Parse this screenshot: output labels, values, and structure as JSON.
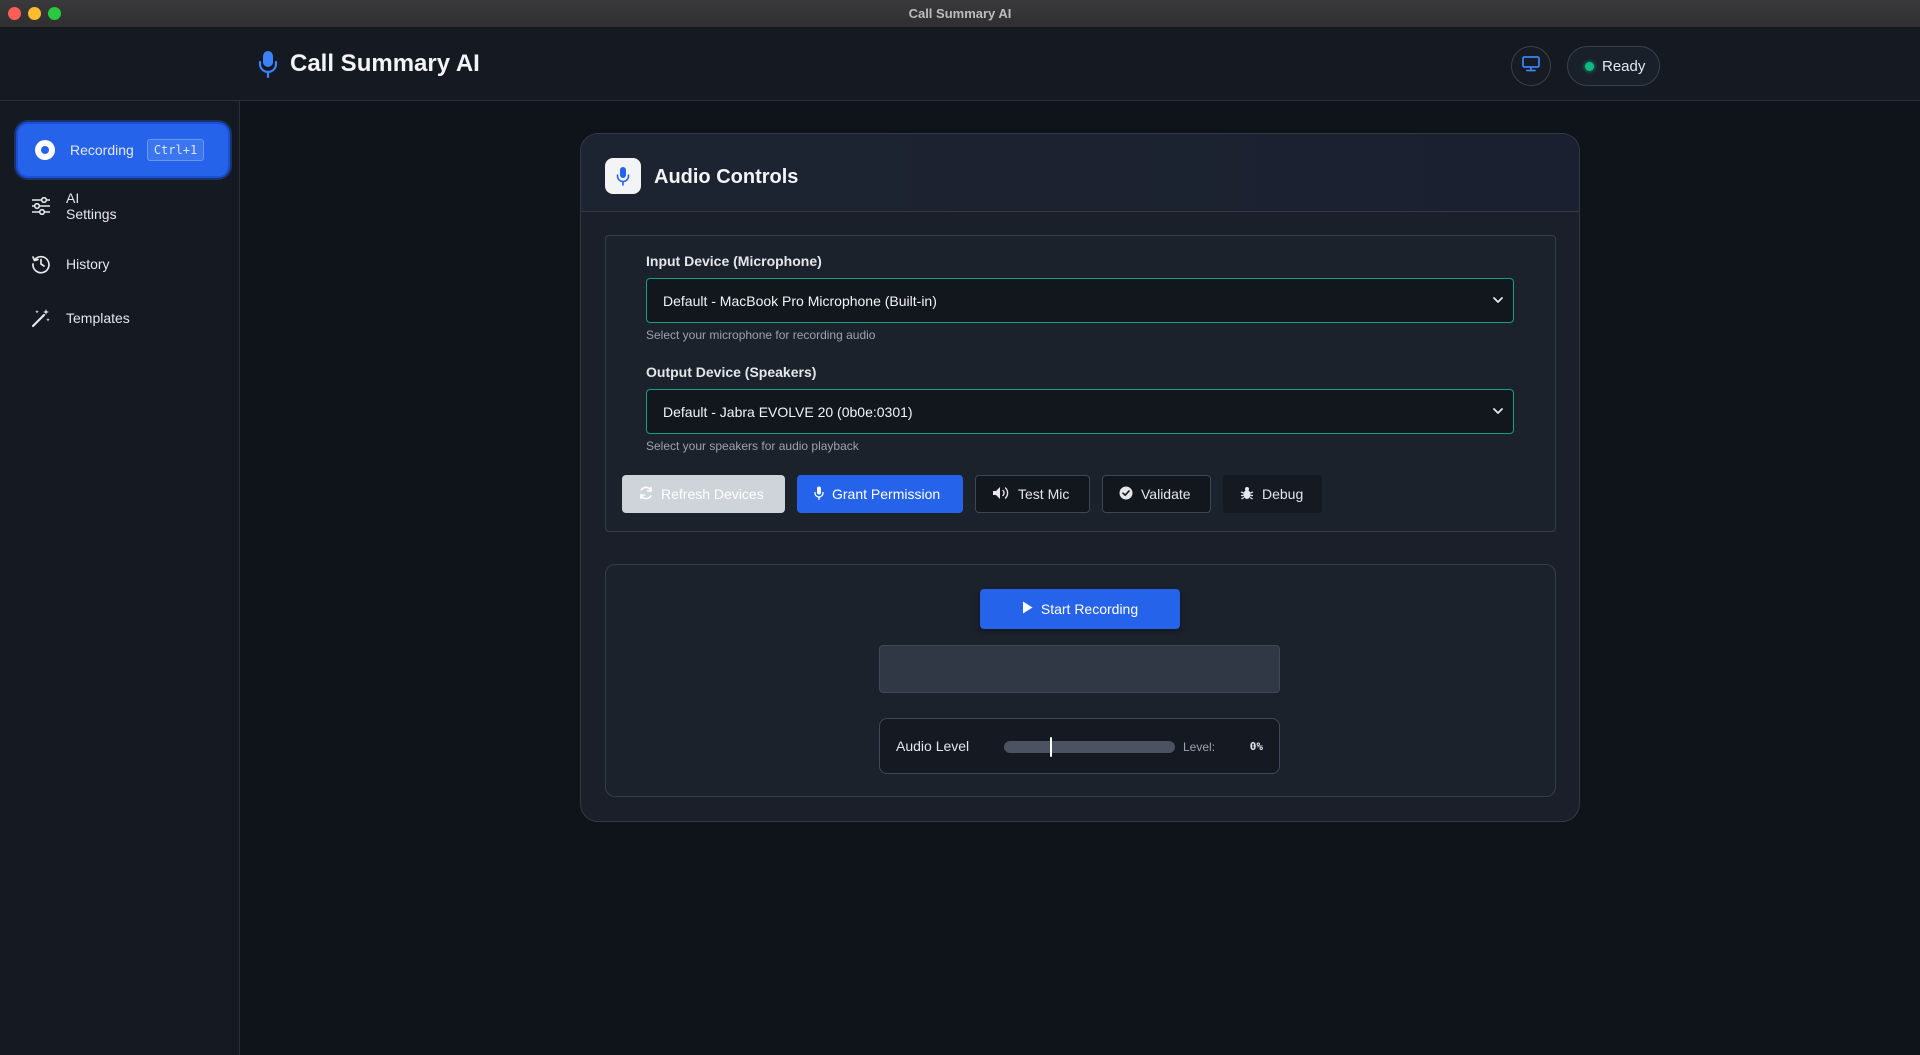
{
  "window": {
    "title": "Call Summary AI"
  },
  "header": {
    "app_title": "Call Summary AI",
    "brand_icon": "microphone-icon",
    "status": "Ready",
    "status_color": "#10b981",
    "display_icon": "monitor-icon"
  },
  "sidebar": {
    "items": [
      {
        "label": "Recording",
        "icon": "record-icon",
        "shortcut": "Ctrl+1",
        "active": true
      },
      {
        "label": "AI\nSettings",
        "icon": "sliders-icon"
      },
      {
        "label": "History",
        "icon": "history-icon"
      },
      {
        "label": "Templates",
        "icon": "magic-wand-icon"
      }
    ]
  },
  "card": {
    "title": "Audio Controls",
    "title_icon": "microphone-icon",
    "input": {
      "label": "Input Device (Microphone)",
      "value": "Default - MacBook Pro Microphone (Built-in)",
      "help": "Select your microphone for recording audio"
    },
    "output": {
      "label": "Output Device (Speakers)",
      "value": "Default - Jabra EVOLVE 20 (0b0e:0301)",
      "help": "Select your speakers for audio playback"
    },
    "buttons": {
      "refresh": "Refresh Devices",
      "grant": "Grant Permission",
      "test": "Test Mic",
      "validate": "Validate",
      "debug": "Debug"
    },
    "recording": {
      "start_label": "Start Recording",
      "level_label": "Audio Level",
      "level_text": "Level:",
      "level_value": "0%"
    }
  },
  "colors": {
    "accent": "#2563eb",
    "select_border": "#10a37f",
    "background": "#0f131a"
  }
}
